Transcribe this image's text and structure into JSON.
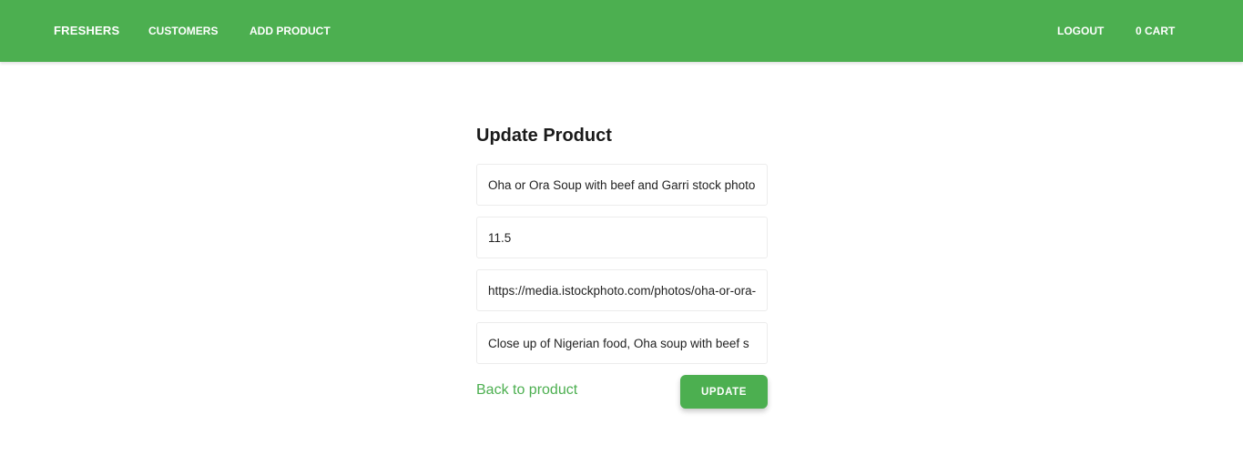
{
  "navbar": {
    "brand": "FRESHERS",
    "links": [
      {
        "label": "CUSTOMERS"
      },
      {
        "label": "ADD PRODUCT"
      }
    ],
    "logout_label": "LOGOUT",
    "cart_label": "0 CART",
    "bg_color": "#4caf50"
  },
  "form": {
    "title": "Update Product",
    "fields": {
      "name": {
        "value": "Oha or Ora Soup with beef and Garri stock photo"
      },
      "price": {
        "value": "11.5"
      },
      "image_url": {
        "value": "https://media.istockphoto.com/photos/oha-or-ora-soup"
      },
      "description": {
        "value": "Close up of Nigerian food, Oha soup with beef s"
      }
    },
    "back_link_label": "Back to product",
    "submit_label": "UPDATE"
  }
}
